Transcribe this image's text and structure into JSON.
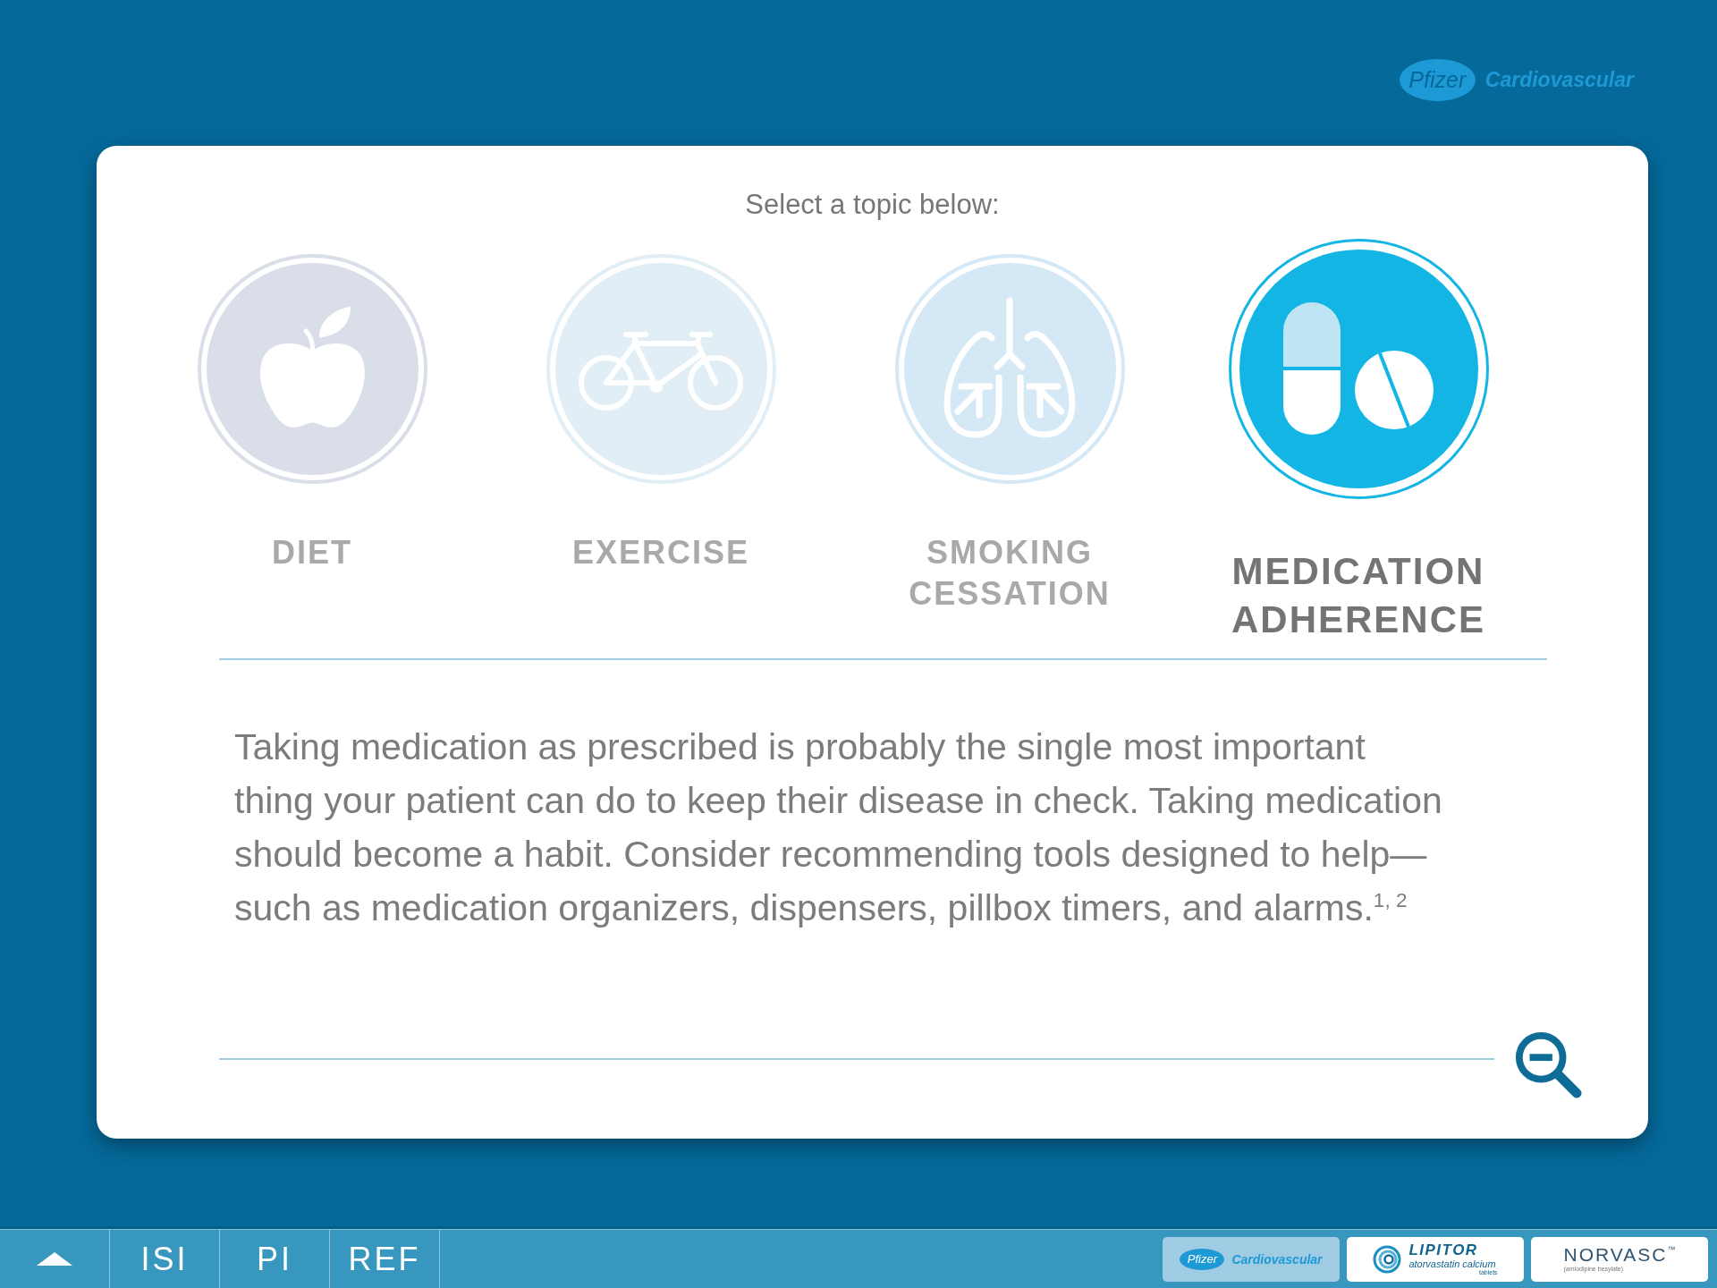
{
  "header": {
    "logo": {
      "mark": "Pfizer",
      "division": "Cardiovascular"
    }
  },
  "card": {
    "prompt": "Select a topic below:",
    "topics": [
      {
        "label": "DIET",
        "kind": "apple",
        "color": "#d9dee8",
        "selected": false
      },
      {
        "label": "EXERCISE",
        "kind": "bicycle",
        "color": "#e1eef6",
        "selected": false
      },
      {
        "label": "SMOKING CESSATION",
        "kind": "lungs",
        "color": "#d4e8f6",
        "selected": false
      },
      {
        "label": "MEDICATION ADHERENCE",
        "kind": "pills",
        "color": "#12b5e3",
        "selected": true
      }
    ],
    "body": "Taking medication as prescribed is probably the single most important thing your patient can do to keep their disease in check. Taking medication should become a habit. Consider recommending tools designed to help—such as medication organizers, dispensers, pillbox timers, and alarms.$^{1, 2}$"
  },
  "footer": {
    "nav": [
      "ISI",
      "PI",
      "REF"
    ],
    "brands": [
      {
        "kind": "pfizer",
        "selected": true,
        "mark": "Pfizer",
        "name": "Cardiovascular"
      },
      {
        "kind": "lipitor",
        "selected": false,
        "name": "LIPITOR",
        "generic": "atorvastatin calcium",
        "form": "tablets"
      },
      {
        "kind": "norvasc",
        "selected": false,
        "name": "NORVASC",
        "trademark": "™",
        "generic": "(amlodipine besylate)"
      }
    ]
  }
}
